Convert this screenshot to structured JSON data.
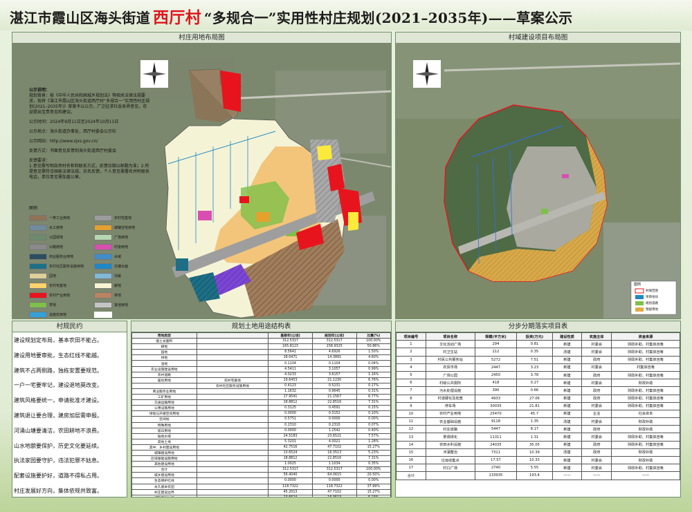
{
  "header": {
    "title_prefix": "湛江市霞山区海头街道",
    "title_village": "西厅村",
    "title_suffix": "“多规合一”实用性村庄规划(2021–2035年)——草案公示"
  },
  "panels": {
    "land_use_map": "村庄用地布局图",
    "project_map": "村域建设项目布局图",
    "pledge": "村规民约",
    "land_table": "规划土地用途结构表",
    "project_table": "分步分期落实项目表"
  },
  "notice": {
    "title": "公示说明：",
    "para1": "规划背景：按《中华人民共和国城乡规划法》等相关法律法规要求，现将《湛江市霞山区海头街道西厅村“多规合一”实用性村庄规划(2021–2035年)》草案予以公示，广泛征求社会各界意见，欢迎提出宝贵意见和建议。",
    "period": "公示时间：2024年9月11日至2024年10月11日",
    "place": "公示地点：海头街道办事处，西厅村委会公示栏",
    "website": "公示网站：http://www.zjxs.gov.cn/",
    "feedback": "反馈方式：书面意见反馈到海头街道西厅村委会",
    "notes_title": "反馈要求：",
    "notes": "1.意见需写明自然村名称和联系方式，反馈日期以邮戳为准；2.所提意见需符合国家法律法规，实名反馈，个人意见需署名并附联系电话，单位意见需加盖公章。"
  },
  "legend": {
    "title": "图例",
    "items": [
      {
        "label": "一类工业用地",
        "color": "#8d7357"
      },
      {
        "label": "农村宅基地",
        "color": "#9c9c9c"
      },
      {
        "label": "水工用地",
        "color": "#6f8b9c"
      },
      {
        "label": "城镇住宅用地",
        "color": "#e3a12e"
      },
      {
        "label": "公园绿地",
        "color": "#6c8b6c"
      },
      {
        "label": "广场用地",
        "color": "#b6d8b0"
      },
      {
        "label": "公路用地",
        "color": "#8a8a8a"
      },
      {
        "label": "村道用地",
        "color": "#d84fb0"
      },
      {
        "label": "商业服务业用地",
        "color": "#2b4e5e"
      },
      {
        "label": "水域",
        "color": "#3f8dc9"
      },
      {
        "label": "农村社区服务设施用地",
        "color": "#1e6f86"
      },
      {
        "label": "坑塘水面",
        "color": "#1e88c7"
      },
      {
        "label": "园地",
        "color": "#ddd098"
      },
      {
        "label": "沟渠",
        "color": "#7fb9d6"
      },
      {
        "label": "农村宅基地",
        "color": "#fbd36b"
      },
      {
        "label": "耕地",
        "color": "#f7f3d0"
      },
      {
        "label": "农村产业用地",
        "color": "#e8141d"
      },
      {
        "label": "林地",
        "color": "#bc8360"
      },
      {
        "label": "草地",
        "color": "#7fbf4a"
      },
      {
        "label": "其他用地",
        "color": "#c5c5c5"
      },
      {
        "label": "设施农用地",
        "color": "#34a0d8"
      },
      {
        "label": "",
        "color": "#ffffff"
      }
    ]
  },
  "project_legend": {
    "title": "图例",
    "items": [
      "村域范围",
      "项目地块",
      "规划道路",
      "预留用地"
    ]
  },
  "pledge": [
    "建设规划定布局，基本农田不能占。",
    "建设用地要审批，生态红线不能越。",
    "建筑不占两侧路，独栋安置要规范。",
    "一户一宅要牢记，建设退地莫改变。",
    "建筑风格要统一，申请批准才建设。",
    "建筑退让要合理，建房加层需申报。",
    "河涌山塘要清洁，农田耕地不浪费。",
    "山水地貌要保护，历史文化要延续。",
    "执法家园要守护，违法犯罪不姑息。",
    "配套设施要护好，道路不得私占用。",
    "村庄发展好方向，集体依规共致富。"
  ],
  "land_table": {
    "headers": [
      "用地类型",
      "",
      "基期年(公顷)",
      "规划年(公顷)",
      "比重(%)"
    ],
    "rows": [
      [
        "国土总面积",
        "",
        "312.5317",
        "312.5317",
        "100.00%"
      ],
      [
        "耕地",
        "",
        "165.8123",
        "158.9325",
        "50.86%"
      ],
      [
        "园地",
        "",
        "8.5641",
        "4.6926",
        "1.50%"
      ],
      [
        "林地",
        "",
        "18.0471",
        "14.3891",
        "4.60%"
      ],
      [
        "湿地",
        "",
        "0.1104",
        "0.1104",
        "0.04%"
      ],
      [
        "农业设施建设用地",
        "",
        "4.5411",
        "3.1057",
        "0.99%"
      ],
      [
        "农村道路",
        "",
        "4.0233",
        "3.6157",
        "1.16%"
      ],
      [
        "居住用地",
        "农村宅基地",
        "19.6453",
        "21.1230",
        "6.76%"
      ],
      [
        "",
        "农村社区服务设施用地",
        "0.4123",
        "0.5231",
        "0.17%"
      ],
      [
        "商业服务业用地",
        "",
        "1.1632",
        "0.9645",
        "0.31%"
      ],
      [
        "工矿用地",
        "",
        "17.9541",
        "21.1567",
        "6.77%"
      ],
      [
        "交通运输用地",
        "",
        "18.8812",
        "22.8516",
        "7.31%"
      ],
      [
        "公用设施用地",
        "",
        "0.3125",
        "0.4591",
        "0.15%"
      ],
      [
        "绿地与开敞空间用地",
        "",
        "0.0000",
        "0.3152",
        "0.10%"
      ],
      [
        "空闲地",
        "",
        "0.5751",
        "0.0000",
        "0.00%"
      ],
      [
        "特殊用地",
        "",
        "0.2310",
        "0.2310",
        "0.07%"
      ],
      [
        "留白用地",
        "",
        "0.0000",
        "1.2542",
        "0.40%"
      ],
      [
        "陆地水域",
        "",
        "24.5183",
        "23.6521",
        "7.57%"
      ],
      [
        "其他土地",
        "",
        "5.3201",
        "4.0021",
        "1.28%"
      ],
      [
        "其中：乡村建设用地",
        "",
        "42.7516",
        "47.7102",
        "15.27%"
      ],
      [
        "城镇建设用地",
        "",
        "13.6524",
        "16.3513",
        "5.23%"
      ],
      [
        "区域基础设施用地",
        "",
        "18.8812",
        "22.8516",
        "7.31%"
      ],
      [
        "其他建设用地",
        "",
        "1.0025",
        "1.1034",
        "0.35%"
      ],
      [
        "合计",
        "",
        "312.5317",
        "312.5317",
        "100.00%"
      ],
      [
        "城乡建设用地",
        "",
        "56.4040",
        "64.0615",
        "20.50%"
      ],
      [
        "生态保护红线",
        "",
        "0.0000",
        "0.0000",
        "0.00%"
      ],
      [
        "永久基本农田",
        "",
        "118.7322",
        "118.7322",
        "37.99%"
      ],
      [
        "村庄建设边界",
        "",
        "45.2013",
        "47.7102",
        "15.27%"
      ],
      [
        "城镇开发边界",
        "",
        "13.6524",
        "16.3513",
        "5.23%"
      ]
    ]
  },
  "project_table": {
    "headers": [
      "项目编号",
      "项目名称",
      "规模(平方米)",
      "投资(万元)",
      "建设性质",
      "实施主体",
      "资金来源"
    ],
    "rows": [
      [
        "1",
        "文化活动广场",
        "294",
        "0.81",
        "新建",
        "村委会",
        "财政补助、村集体自筹"
      ],
      [
        "2",
        "村卫生站",
        "212",
        "0.35",
        "改建",
        "村委会",
        "财政补助、村集体自筹"
      ],
      [
        "3",
        "村民公共服务站",
        "5272",
        "7.51",
        "新建",
        "政府",
        "财政补助、村集体自筹"
      ],
      [
        "4",
        "农贸市场",
        "2447",
        "3.23",
        "新建",
        "村委会",
        "村集体自筹"
      ],
      [
        "5",
        "广场公园",
        "2450",
        "3.78",
        "新建",
        "政府",
        "财政补助、村集体自筹"
      ],
      [
        "6",
        "村级公共厕所",
        "418",
        "0.27",
        "新建",
        "村委会",
        "财政补助"
      ],
      [
        "7",
        "污水处理设施",
        "390",
        "0.66",
        "新建",
        "政府",
        "财政补助、村集体自筹"
      ],
      [
        "8",
        "村道硬化及拓宽",
        "4933",
        "27.06",
        "新建",
        "政府",
        "财政补助、村集体自筹"
      ],
      [
        "9",
        "停车场",
        "30035",
        "21.81",
        "新建",
        "村委会",
        "财政补助、村集体自筹"
      ],
      [
        "10",
        "农村产业用地",
        "25470",
        "45.7",
        "新建",
        "企业",
        "社会资本"
      ],
      [
        "11",
        "农业基础设施",
        "9118",
        "1.35",
        "改建",
        "村委会",
        "财政补助"
      ],
      [
        "12",
        "村庄道路",
        "5447",
        "8.17",
        "新建",
        "政府",
        "财政补助"
      ],
      [
        "13",
        "景观绿化",
        "11311",
        "1.31",
        "新建",
        "村委会",
        "财政补助、村集体自筹"
      ],
      [
        "14",
        "农田水利设施",
        "24035",
        "35.05",
        "新建",
        "政府",
        "财政补助、村集体自筹"
      ],
      [
        "15",
        "河涌整治",
        "7311",
        "10.39",
        "改建",
        "政府",
        "财政补助"
      ],
      [
        "16",
        "垃圾收集点",
        "17.57",
        "10.33",
        "新建",
        "村委会",
        "财政补助"
      ],
      [
        "17",
        "村口广场",
        "2740",
        "5.55",
        "新建",
        "村委会",
        "财政补助、村集体自筹"
      ],
      [
        "合计",
        "",
        "133935",
        "193.4",
        "——",
        "——",
        "——"
      ]
    ]
  }
}
